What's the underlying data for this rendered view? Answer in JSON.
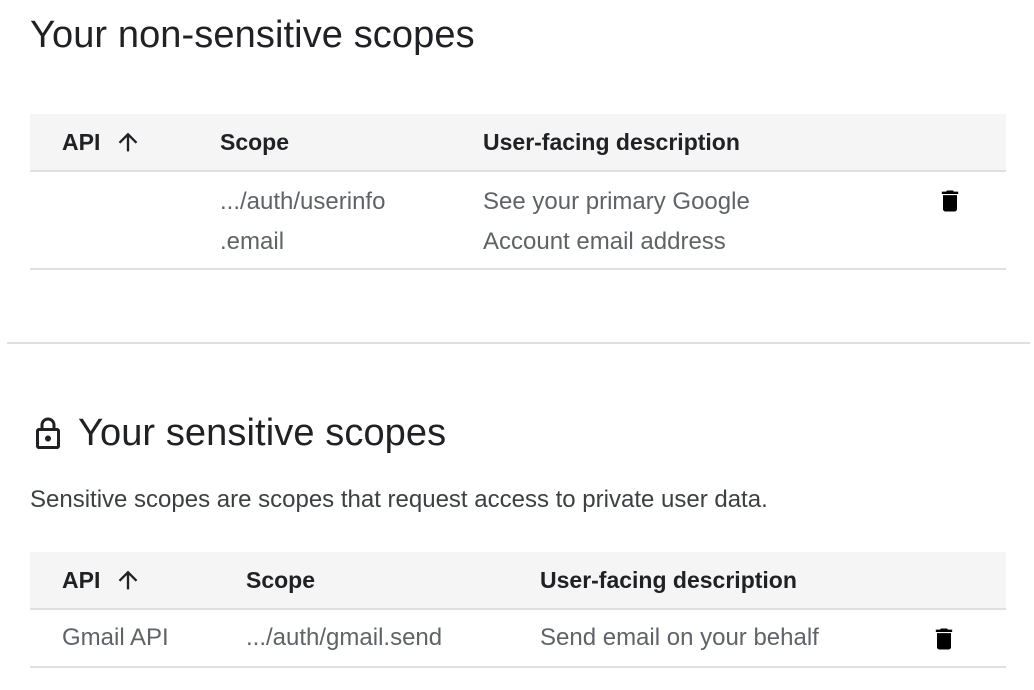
{
  "non_sensitive": {
    "title": "Your non-sensitive scopes",
    "headers": {
      "api": "API",
      "scope": "Scope",
      "description": "User-facing description"
    },
    "rows": [
      {
        "api": "",
        "scope_line1": ".../auth/userinfo",
        "scope_line2": ".email",
        "desc_line1": "See your primary Google",
        "desc_line2": "Account email address"
      }
    ]
  },
  "sensitive": {
    "title": "Your sensitive scopes",
    "description": "Sensitive scopes are scopes that request access to private user data.",
    "headers": {
      "api": "API",
      "scope": "Scope",
      "description": "User-facing description"
    },
    "rows": [
      {
        "api": "Gmail API",
        "scope": ".../auth/gmail.send",
        "description": "Send email on your behalf"
      }
    ]
  },
  "icons": {
    "sort": "arrow-up-icon",
    "delete": "trash-icon",
    "lock": "lock-icon"
  }
}
